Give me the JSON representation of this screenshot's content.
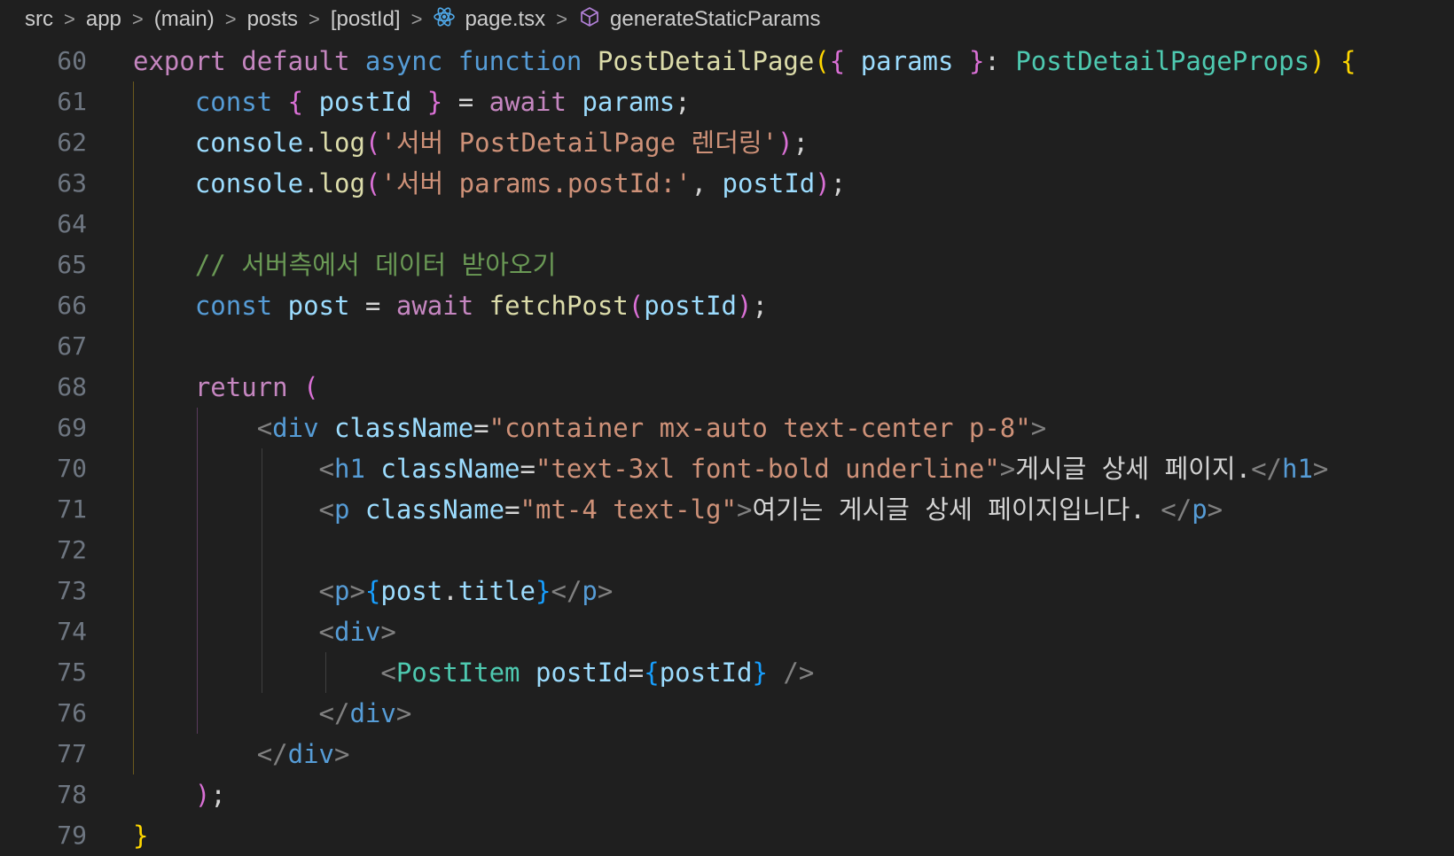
{
  "breadcrumb": {
    "items": [
      {
        "label": "src",
        "icon": ""
      },
      {
        "label": "app",
        "icon": ""
      },
      {
        "label": "(main)",
        "icon": ""
      },
      {
        "label": "posts",
        "icon": ""
      },
      {
        "label": "[postId]",
        "icon": ""
      },
      {
        "label": "page.tsx",
        "icon": "react-icon"
      },
      {
        "label": "generateStaticParams",
        "icon": "cube-symbol-icon"
      }
    ],
    "separator": ">"
  },
  "colors": {
    "background": "#1f1f1f",
    "keyword": "#c586c0",
    "storage": "#569cd6",
    "function": "#dcdcaa",
    "variable": "#9cdcfe",
    "type": "#4ec9b0",
    "string": "#ce9178",
    "comment": "#6a9955",
    "bracket_gold": "#ffd700",
    "bracket_pink": "#da70d6",
    "bracket_blue": "#179fff",
    "tag_bracket": "#808080",
    "line_number": "#6e7681"
  },
  "editor": {
    "lines": [
      {
        "num": "60",
        "tokens": [
          {
            "t": "export",
            "c": "keyword"
          },
          {
            "t": " ",
            "c": "plain"
          },
          {
            "t": "default",
            "c": "keyword"
          },
          {
            "t": " ",
            "c": "plain"
          },
          {
            "t": "async",
            "c": "storage"
          },
          {
            "t": " ",
            "c": "plain"
          },
          {
            "t": "function",
            "c": "storage"
          },
          {
            "t": " ",
            "c": "plain"
          },
          {
            "t": "PostDetailPage",
            "c": "function"
          },
          {
            "t": "(",
            "c": "bracket_gold"
          },
          {
            "t": "{",
            "c": "bracket_pink"
          },
          {
            "t": " ",
            "c": "plain"
          },
          {
            "t": "params",
            "c": "variable"
          },
          {
            "t": " ",
            "c": "plain"
          },
          {
            "t": "}",
            "c": "bracket_pink"
          },
          {
            "t": ": ",
            "c": "plain"
          },
          {
            "t": "PostDetailPageProps",
            "c": "type"
          },
          {
            "t": ")",
            "c": "bracket_gold"
          },
          {
            "t": " ",
            "c": "plain"
          },
          {
            "t": "{",
            "c": "bracket_gold"
          }
        ]
      },
      {
        "num": "61",
        "tokens": [
          {
            "t": "    ",
            "c": "plain"
          },
          {
            "t": "const",
            "c": "storage"
          },
          {
            "t": " ",
            "c": "plain"
          },
          {
            "t": "{",
            "c": "bracket_pink"
          },
          {
            "t": " ",
            "c": "plain"
          },
          {
            "t": "postId",
            "c": "variable"
          },
          {
            "t": " ",
            "c": "plain"
          },
          {
            "t": "}",
            "c": "bracket_pink"
          },
          {
            "t": " = ",
            "c": "plain"
          },
          {
            "t": "await",
            "c": "keyword"
          },
          {
            "t": " ",
            "c": "plain"
          },
          {
            "t": "params",
            "c": "variable"
          },
          {
            "t": ";",
            "c": "plain"
          }
        ]
      },
      {
        "num": "62",
        "tokens": [
          {
            "t": "    ",
            "c": "plain"
          },
          {
            "t": "console",
            "c": "variable"
          },
          {
            "t": ".",
            "c": "plain"
          },
          {
            "t": "log",
            "c": "function"
          },
          {
            "t": "(",
            "c": "bracket_pink"
          },
          {
            "t": "'서버 PostDetailPage 렌더링'",
            "c": "string"
          },
          {
            "t": ")",
            "c": "bracket_pink"
          },
          {
            "t": ";",
            "c": "plain"
          }
        ]
      },
      {
        "num": "63",
        "tokens": [
          {
            "t": "    ",
            "c": "plain"
          },
          {
            "t": "console",
            "c": "variable"
          },
          {
            "t": ".",
            "c": "plain"
          },
          {
            "t": "log",
            "c": "function"
          },
          {
            "t": "(",
            "c": "bracket_pink"
          },
          {
            "t": "'서버 params.postId:'",
            "c": "string"
          },
          {
            "t": ", ",
            "c": "plain"
          },
          {
            "t": "postId",
            "c": "variable"
          },
          {
            "t": ")",
            "c": "bracket_pink"
          },
          {
            "t": ";",
            "c": "plain"
          }
        ]
      },
      {
        "num": "64",
        "tokens": []
      },
      {
        "num": "65",
        "tokens": [
          {
            "t": "    ",
            "c": "plain"
          },
          {
            "t": "// 서버측에서 데이터 받아오기",
            "c": "comment"
          }
        ]
      },
      {
        "num": "66",
        "tokens": [
          {
            "t": "    ",
            "c": "plain"
          },
          {
            "t": "const",
            "c": "storage"
          },
          {
            "t": " ",
            "c": "plain"
          },
          {
            "t": "post",
            "c": "variable"
          },
          {
            "t": " = ",
            "c": "plain"
          },
          {
            "t": "await",
            "c": "keyword"
          },
          {
            "t": " ",
            "c": "plain"
          },
          {
            "t": "fetchPost",
            "c": "function"
          },
          {
            "t": "(",
            "c": "bracket_pink"
          },
          {
            "t": "postId",
            "c": "variable"
          },
          {
            "t": ")",
            "c": "bracket_pink"
          },
          {
            "t": ";",
            "c": "plain"
          }
        ]
      },
      {
        "num": "67",
        "tokens": []
      },
      {
        "num": "68",
        "tokens": [
          {
            "t": "    ",
            "c": "plain"
          },
          {
            "t": "return",
            "c": "keyword"
          },
          {
            "t": " ",
            "c": "plain"
          },
          {
            "t": "(",
            "c": "bracket_pink"
          }
        ]
      },
      {
        "num": "69",
        "tokens": [
          {
            "t": "        ",
            "c": "plain"
          },
          {
            "t": "<",
            "c": "tag_bracket"
          },
          {
            "t": "div",
            "c": "storage"
          },
          {
            "t": " ",
            "c": "plain"
          },
          {
            "t": "className",
            "c": "variable"
          },
          {
            "t": "=",
            "c": "plain"
          },
          {
            "t": "\"container mx-auto text-center p-8\"",
            "c": "string"
          },
          {
            "t": ">",
            "c": "tag_bracket"
          }
        ]
      },
      {
        "num": "70",
        "tokens": [
          {
            "t": "            ",
            "c": "plain"
          },
          {
            "t": "<",
            "c": "tag_bracket"
          },
          {
            "t": "h1",
            "c": "storage"
          },
          {
            "t": " ",
            "c": "plain"
          },
          {
            "t": "className",
            "c": "variable"
          },
          {
            "t": "=",
            "c": "plain"
          },
          {
            "t": "\"text-3xl font-bold underline\"",
            "c": "string"
          },
          {
            "t": ">",
            "c": "tag_bracket"
          },
          {
            "t": "게시글 상세 페이지.",
            "c": "plain"
          },
          {
            "t": "</",
            "c": "tag_bracket"
          },
          {
            "t": "h1",
            "c": "storage"
          },
          {
            "t": ">",
            "c": "tag_bracket"
          }
        ]
      },
      {
        "num": "71",
        "tokens": [
          {
            "t": "            ",
            "c": "plain"
          },
          {
            "t": "<",
            "c": "tag_bracket"
          },
          {
            "t": "p",
            "c": "storage"
          },
          {
            "t": " ",
            "c": "plain"
          },
          {
            "t": "className",
            "c": "variable"
          },
          {
            "t": "=",
            "c": "plain"
          },
          {
            "t": "\"mt-4 text-lg\"",
            "c": "string"
          },
          {
            "t": ">",
            "c": "tag_bracket"
          },
          {
            "t": "여기는 게시글 상세 페이지입니다. ",
            "c": "plain"
          },
          {
            "t": "</",
            "c": "tag_bracket"
          },
          {
            "t": "p",
            "c": "storage"
          },
          {
            "t": ">",
            "c": "tag_bracket"
          }
        ]
      },
      {
        "num": "72",
        "tokens": []
      },
      {
        "num": "73",
        "tokens": [
          {
            "t": "            ",
            "c": "plain"
          },
          {
            "t": "<",
            "c": "tag_bracket"
          },
          {
            "t": "p",
            "c": "storage"
          },
          {
            "t": ">",
            "c": "tag_bracket"
          },
          {
            "t": "{",
            "c": "bracket_blue"
          },
          {
            "t": "post",
            "c": "variable"
          },
          {
            "t": ".",
            "c": "plain"
          },
          {
            "t": "title",
            "c": "variable"
          },
          {
            "t": "}",
            "c": "bracket_blue"
          },
          {
            "t": "</",
            "c": "tag_bracket"
          },
          {
            "t": "p",
            "c": "storage"
          },
          {
            "t": ">",
            "c": "tag_bracket"
          }
        ]
      },
      {
        "num": "74",
        "tokens": [
          {
            "t": "            ",
            "c": "plain"
          },
          {
            "t": "<",
            "c": "tag_bracket"
          },
          {
            "t": "div",
            "c": "storage"
          },
          {
            "t": ">",
            "c": "tag_bracket"
          }
        ]
      },
      {
        "num": "75",
        "tokens": [
          {
            "t": "                ",
            "c": "plain"
          },
          {
            "t": "<",
            "c": "tag_bracket"
          },
          {
            "t": "PostItem",
            "c": "type"
          },
          {
            "t": " ",
            "c": "plain"
          },
          {
            "t": "postId",
            "c": "variable"
          },
          {
            "t": "=",
            "c": "plain"
          },
          {
            "t": "{",
            "c": "bracket_blue"
          },
          {
            "t": "postId",
            "c": "variable"
          },
          {
            "t": "}",
            "c": "bracket_blue"
          },
          {
            "t": " ",
            "c": "plain"
          },
          {
            "t": "/>",
            "c": "tag_bracket"
          }
        ]
      },
      {
        "num": "76",
        "tokens": [
          {
            "t": "            ",
            "c": "plain"
          },
          {
            "t": "</",
            "c": "tag_bracket"
          },
          {
            "t": "div",
            "c": "storage"
          },
          {
            "t": ">",
            "c": "tag_bracket"
          }
        ]
      },
      {
        "num": "77",
        "tokens": [
          {
            "t": "        ",
            "c": "plain"
          },
          {
            "t": "</",
            "c": "tag_bracket"
          },
          {
            "t": "div",
            "c": "storage"
          },
          {
            "t": ">",
            "c": "tag_bracket"
          }
        ]
      },
      {
        "num": "78",
        "tokens": [
          {
            "t": "    ",
            "c": "plain"
          },
          {
            "t": ")",
            "c": "bracket_pink"
          },
          {
            "t": ";",
            "c": "plain"
          }
        ]
      },
      {
        "num": "79",
        "tokens": [
          {
            "t": "}",
            "c": "bracket_gold"
          }
        ]
      }
    ]
  }
}
